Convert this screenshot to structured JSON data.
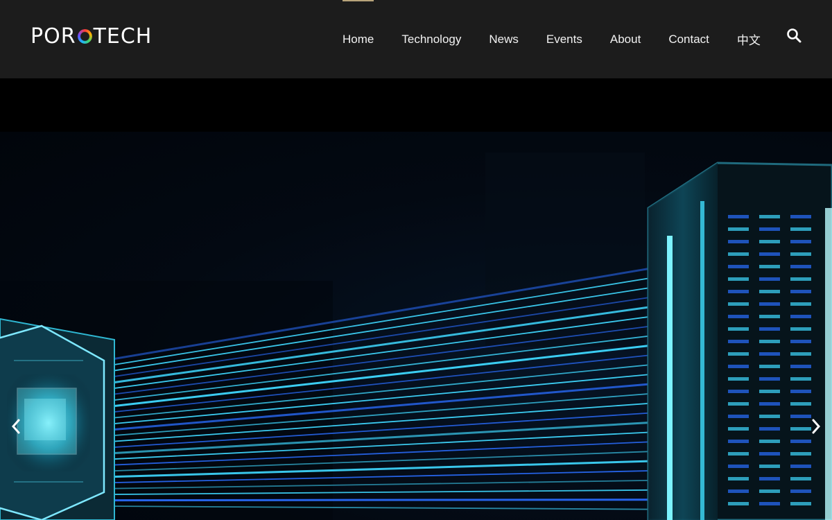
{
  "brand": {
    "logo_left": "POR",
    "logo_right": "TECH"
  },
  "nav": {
    "items": [
      {
        "label": "Home",
        "active": true
      },
      {
        "label": "Technology"
      },
      {
        "label": "News"
      },
      {
        "label": "Events"
      },
      {
        "label": "About"
      },
      {
        "label": "Contact"
      },
      {
        "label": "中文"
      }
    ],
    "search_icon": "search-icon"
  },
  "hero": {
    "image": "photonic-chip-to-server-rack-illustration",
    "prev_icon": "chevron-left-icon",
    "next_icon": "chevron-right-icon"
  },
  "colors": {
    "header_bg": "#1c1c1c",
    "active_indicator": "#b8a47a",
    "beam_cyan": "#3fd8ff",
    "beam_blue": "#2a6dff"
  }
}
